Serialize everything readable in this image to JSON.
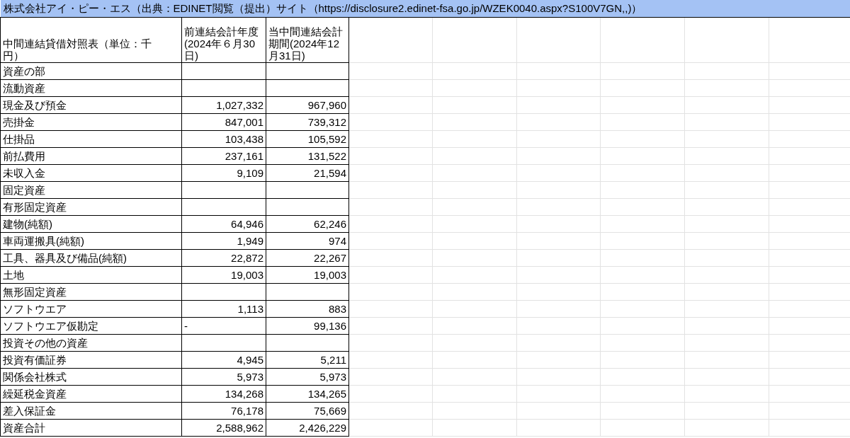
{
  "title": "株式会社アイ・ピー・エス（出典：EDINET閲覧（提出）サイト（https://disclosure2.edinet-fsa.go.jp/WZEK0040.aspx?S100V7GN,,)）",
  "table": {
    "columns": [
      "中間連結貸借対照表（単位：千円）",
      "前連結会計年度(2024年６月30日)",
      "当中間連結会計期間(2024年12月31日)"
    ],
    "rows": [
      {
        "label": "資産の部"
      },
      {
        "label": "流動資産"
      },
      {
        "label": "現金及び預金",
        "cells": [
          {
            "text": "1,027,332",
            "kind": "number"
          },
          {
            "text": "967,960",
            "kind": "number"
          }
        ]
      },
      {
        "label": "売掛金",
        "cells": [
          {
            "text": "847,001",
            "kind": "number"
          },
          {
            "text": "739,312",
            "kind": "number"
          }
        ]
      },
      {
        "label": "仕掛品",
        "cells": [
          {
            "text": "103,438",
            "kind": "number"
          },
          {
            "text": "105,592",
            "kind": "number"
          }
        ]
      },
      {
        "label": "前払費用",
        "cells": [
          {
            "text": "237,161",
            "kind": "number"
          },
          {
            "text": "131,522",
            "kind": "number"
          }
        ]
      },
      {
        "label": "未収入金",
        "cells": [
          {
            "text": "9,109",
            "kind": "number"
          },
          {
            "text": "21,594",
            "kind": "number"
          }
        ]
      },
      {
        "label": "固定資産"
      },
      {
        "label": "有形固定資産"
      },
      {
        "label": "建物(純額)",
        "cells": [
          {
            "text": "64,946",
            "kind": "number"
          },
          {
            "text": "62,246",
            "kind": "number"
          }
        ]
      },
      {
        "label": "車両運搬具(純額)",
        "cells": [
          {
            "text": "1,949",
            "kind": "number"
          },
          {
            "text": "974",
            "kind": "number"
          }
        ]
      },
      {
        "label": "工具、器具及び備品(純額)",
        "cells": [
          {
            "text": "22,872",
            "kind": "number"
          },
          {
            "text": "22,267",
            "kind": "number"
          }
        ]
      },
      {
        "label": "土地",
        "cells": [
          {
            "text": "19,003",
            "kind": "number"
          },
          {
            "text": "19,003",
            "kind": "number"
          }
        ]
      },
      {
        "label": "無形固定資産"
      },
      {
        "label": "ソフトウエア",
        "cells": [
          {
            "text": "1,113",
            "kind": "number"
          },
          {
            "text": "883",
            "kind": "number"
          }
        ]
      },
      {
        "label": "ソフトウエア仮勘定",
        "cells": [
          {
            "text": "-",
            "kind": "text"
          },
          {
            "text": "99,136",
            "kind": "number"
          }
        ]
      },
      {
        "label": "投資その他の資産"
      },
      {
        "label": "投資有価証券",
        "cells": [
          {
            "text": "4,945",
            "kind": "number"
          },
          {
            "text": "5,211",
            "kind": "number"
          }
        ]
      },
      {
        "label": "関係会社株式",
        "cells": [
          {
            "text": "5,973",
            "kind": "number"
          },
          {
            "text": "5,973",
            "kind": "number"
          }
        ]
      },
      {
        "label": "繰延税金資産",
        "cells": [
          {
            "text": "134,268",
            "kind": "number"
          },
          {
            "text": "134,265",
            "kind": "number"
          }
        ]
      },
      {
        "label": "差入保証金",
        "cells": [
          {
            "text": "76,178",
            "kind": "number"
          },
          {
            "text": "75,669",
            "kind": "number"
          }
        ]
      },
      {
        "label": "資産合計",
        "cells": [
          {
            "text": "2,588,962",
            "kind": "number"
          },
          {
            "text": "2,426,229",
            "kind": "number"
          }
        ]
      }
    ]
  }
}
